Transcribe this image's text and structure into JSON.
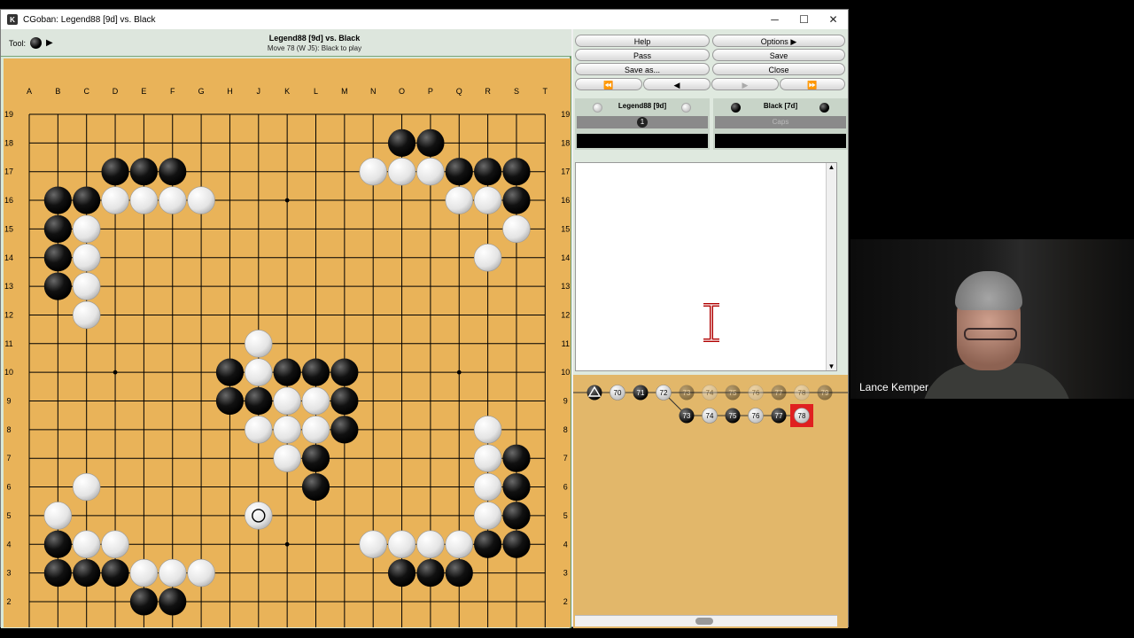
{
  "window": {
    "title": "CGoban: Legend88 [9d] vs. Black",
    "controls": [
      "─",
      "☐",
      "✕"
    ]
  },
  "toolbar": {
    "tool_label": "Tool:",
    "game_title": "Legend88 [9d] vs. Black",
    "move_status": "Move 78 (W J5): Black to play"
  },
  "board": {
    "size": 19,
    "columns": [
      "A",
      "B",
      "C",
      "D",
      "E",
      "F",
      "G",
      "H",
      "J",
      "K",
      "L",
      "M",
      "N",
      "O",
      "P",
      "Q",
      "R",
      "S",
      "T"
    ],
    "rows": [
      "19",
      "18",
      "17",
      "16",
      "15",
      "14",
      "13",
      "12",
      "11",
      "10",
      "9",
      "8",
      "7",
      "6",
      "5",
      "4",
      "3",
      "2",
      "1"
    ],
    "hoshi": [
      "D16",
      "K16",
      "Q16",
      "D10",
      "K10",
      "Q10",
      "D4",
      "K4",
      "Q4"
    ],
    "black_stones": [
      "O18",
      "P18",
      "D17",
      "E17",
      "F17",
      "Q17",
      "R17",
      "S17",
      "B16",
      "C16",
      "S16",
      "B15",
      "B14",
      "B13",
      "H10",
      "K10",
      "L10",
      "M10",
      "H9",
      "J9",
      "M9",
      "M8",
      "L7",
      "L6",
      "S7",
      "S6",
      "S5",
      "B4",
      "R4",
      "S4",
      "B3",
      "C3",
      "D3",
      "O3",
      "P3",
      "Q3",
      "E2",
      "F2"
    ],
    "white_stones": [
      "N17",
      "O17",
      "P17",
      "D16",
      "E16",
      "F16",
      "G16",
      "Q16",
      "R16",
      "C15",
      "S15",
      "C14",
      "R14",
      "C13",
      "C12",
      "J11",
      "J10",
      "K9",
      "L9",
      "J8",
      "K8",
      "L8",
      "R8",
      "K7",
      "R7",
      "R6",
      "C6",
      "R5",
      "B5",
      "J5",
      "C4",
      "D4",
      "N4",
      "O4",
      "P4",
      "Q4",
      "E3",
      "F3",
      "G3"
    ],
    "last_move": "J5"
  },
  "buttons": {
    "help": "Help",
    "options": "Options",
    "pass": "Pass",
    "save": "Save",
    "save_as": "Save as...",
    "close": "Close"
  },
  "navigation": [
    "⏪",
    "◀",
    "▶",
    "⏩"
  ],
  "players": {
    "white": {
      "name": "Legend88 [9d]",
      "captures": "1",
      "clock": ""
    },
    "black": {
      "name": "Black [7d]",
      "captures": "Caps",
      "clock": ""
    }
  },
  "game_tree": {
    "main_line": [
      {
        "label": "",
        "color": "black",
        "marker": "triangle"
      },
      {
        "label": "70",
        "color": "white"
      },
      {
        "label": "71",
        "color": "black"
      },
      {
        "label": "72",
        "color": "white"
      },
      {
        "label": "73",
        "color": "black",
        "faded": true
      },
      {
        "label": "74",
        "color": "white",
        "faded": true
      },
      {
        "label": "75",
        "color": "black",
        "faded": true
      },
      {
        "label": "76",
        "color": "white",
        "faded": true
      },
      {
        "label": "77",
        "color": "black",
        "faded": true
      },
      {
        "label": "78",
        "color": "white",
        "faded": true
      },
      {
        "label": "79",
        "color": "black",
        "faded": true
      }
    ],
    "variation": [
      {
        "label": "73",
        "color": "black"
      },
      {
        "label": "74",
        "color": "white"
      },
      {
        "label": "75",
        "color": "black"
      },
      {
        "label": "76",
        "color": "white"
      },
      {
        "label": "77",
        "color": "black"
      },
      {
        "label": "78",
        "color": "white",
        "current": true
      }
    ]
  },
  "webcam": {
    "name": "Lance Kemper"
  },
  "colors": {
    "board": "#e9b359",
    "line": "#000000",
    "current_move": "#e02020",
    "panel": "#dfe9df"
  }
}
